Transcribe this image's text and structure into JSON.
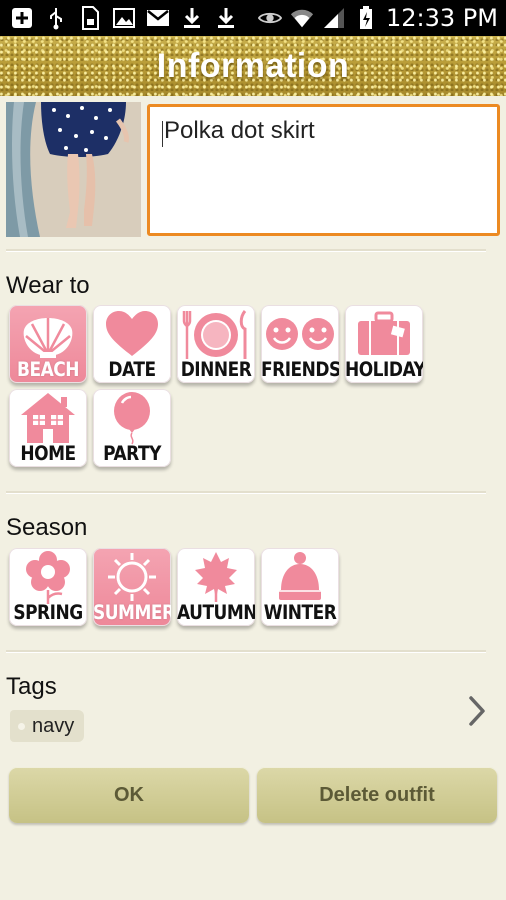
{
  "status_bar": {
    "time": "12:33 PM",
    "left_icons": [
      "add-icon",
      "usb-icon",
      "sd-card-icon",
      "image-icon",
      "gmail-icon",
      "download-icon",
      "download-icon"
    ],
    "right_icons": [
      "eye-icon",
      "wifi-icon",
      "signal-icon",
      "battery-charging-icon"
    ]
  },
  "header": {
    "title": "Information"
  },
  "outfit": {
    "name": "Polka dot skirt"
  },
  "wear_to": {
    "label": "Wear to",
    "items": [
      {
        "label": "BEACH",
        "icon": "shell-icon",
        "selected": true
      },
      {
        "label": "DATE",
        "icon": "heart-icon",
        "selected": false
      },
      {
        "label": "DINNER",
        "icon": "plate-icon",
        "selected": false
      },
      {
        "label": "FRIENDS",
        "icon": "smiley-faces-icon",
        "selected": false
      },
      {
        "label": "HOLIDAY",
        "icon": "suitcase-icon",
        "selected": false
      },
      {
        "label": "HOME",
        "icon": "house-icon",
        "selected": false
      },
      {
        "label": "PARTY",
        "icon": "balloon-icon",
        "selected": false
      }
    ]
  },
  "season": {
    "label": "Season",
    "items": [
      {
        "label": "SPRING",
        "icon": "flower-icon",
        "selected": false
      },
      {
        "label": "SUMMER",
        "icon": "sun-icon",
        "selected": true
      },
      {
        "label": "AUTUMN",
        "icon": "leaf-icon",
        "selected": false
      },
      {
        "label": "WINTER",
        "icon": "beanie-icon",
        "selected": false
      }
    ]
  },
  "tags": {
    "label": "Tags",
    "items": [
      "navy"
    ]
  },
  "buttons": {
    "ok": "OK",
    "delete": "Delete outfit"
  },
  "colors": {
    "accent": "#ec8a22",
    "pink": "#f08a9c",
    "button": "#d2ce98",
    "background": "#f2f0e2"
  }
}
